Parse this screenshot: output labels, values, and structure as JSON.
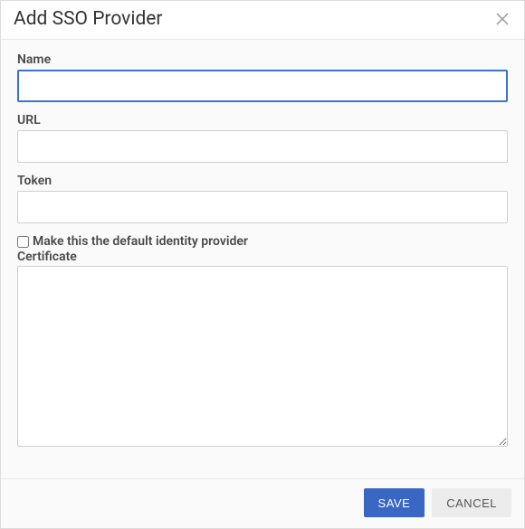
{
  "header": {
    "title": "Add SSO Provider"
  },
  "form": {
    "name_label": "Name",
    "name_value": "",
    "url_label": "URL",
    "url_value": "",
    "token_label": "Token",
    "token_value": "",
    "default_checkbox_label": "Make this the default identity provider",
    "default_checked": false,
    "certificate_label": "Certificate",
    "certificate_value": ""
  },
  "footer": {
    "save_label": "SAVE",
    "cancel_label": "CANCEL"
  }
}
